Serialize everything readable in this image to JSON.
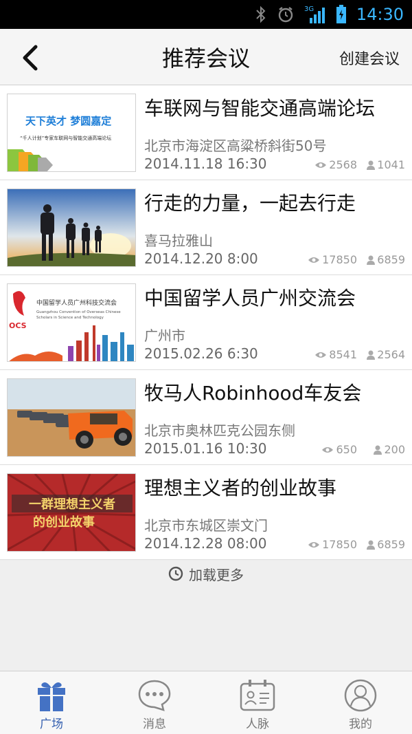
{
  "status_bar": {
    "network": "3G",
    "time": "14:30"
  },
  "header": {
    "title": "推荐会议",
    "create_label": "创建会议"
  },
  "meetings": [
    {
      "title": "车联网与智能交通高端论坛",
      "location": "北京市海淀区高粱桥斜街50号",
      "datetime": "2014.11.18 16:30",
      "views": "2568",
      "members": "1041",
      "thumb": {
        "headline": "天下英才 梦圆嘉定",
        "caption": "“千人计划”专家车联网与智能交通高端论坛"
      }
    },
    {
      "title": "行走的力量，一起去行走",
      "location": "喜马拉雅山",
      "datetime": "2014.12.20 8:00",
      "views": "17850",
      "members": "6859",
      "thumb": {}
    },
    {
      "title": "中国留学人员广州交流会",
      "location": "广州市",
      "datetime": "2015.02.26 6:30",
      "views": "8541",
      "members": "2564",
      "thumb": {
        "logo": "OCS",
        "headline": "中国留学人员广州科技交流会",
        "caption_line1": "Guangzhou Convention of Overseas Chinese",
        "caption_line2": "Scholars in Science and Technology"
      }
    },
    {
      "title": "牧马人Robinhood车友会",
      "location": "北京市奥林匹克公园东侧",
      "datetime": "2015.01.16 10:30",
      "views": "650",
      "members": "200",
      "thumb": {}
    },
    {
      "title": "理想主义者的创业故事",
      "location": "北京市东城区崇文门",
      "datetime": "2014.12.28 08:00",
      "views": "17850",
      "members": "6859",
      "thumb": {
        "line1": "一群理想主义者",
        "line2": "的创业故事"
      }
    }
  ],
  "load_more": "加载更多",
  "bottom_nav": [
    {
      "label": "广场",
      "icon": "gift-icon",
      "active": true
    },
    {
      "label": "消息",
      "icon": "chat-bubble-icon",
      "active": false
    },
    {
      "label": "人脉",
      "icon": "contact-card-icon",
      "active": false
    },
    {
      "label": "我的",
      "icon": "user-profile-icon",
      "active": false
    }
  ],
  "colors": {
    "accent": "#3560b0",
    "status_blue": "#3ab7ff"
  }
}
